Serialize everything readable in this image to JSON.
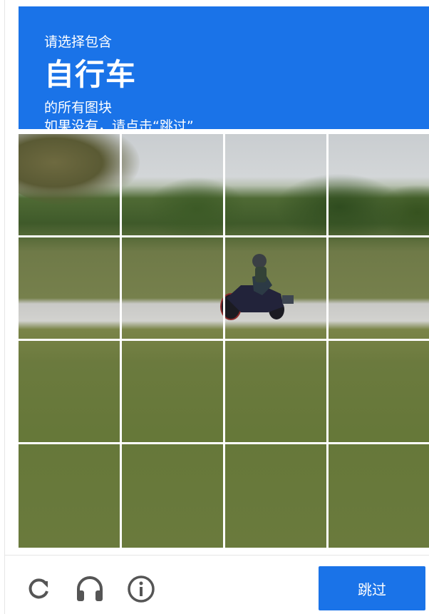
{
  "header": {
    "instruction": "请选择包含",
    "target": "自行车",
    "line1": "的所有图块",
    "line2": "如果没有，请点击“跳过”"
  },
  "grid": {
    "rows": 4,
    "cols": 4
  },
  "footer": {
    "reload_icon": "reload-icon",
    "audio_icon": "headphones-icon",
    "info_icon": "info-icon",
    "skip_label": "跳过"
  },
  "colors": {
    "accent": "#1a73e8",
    "icon": "#555555"
  }
}
